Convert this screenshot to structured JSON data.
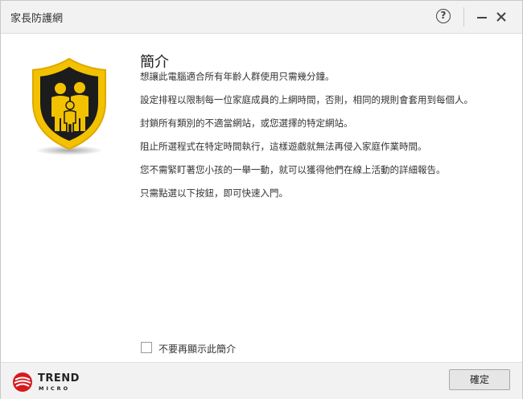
{
  "window": {
    "title": "家長防護網",
    "help_icon": "question-circle-icon",
    "minimize_icon": "minimize-icon",
    "close_icon": "close-icon"
  },
  "intro": {
    "icon": "family-shield-icon",
    "heading": "簡介",
    "paragraphs": [
      "想讓此電腦適合所有年齡人群使用只需幾分鐘。",
      "設定排程以限制每一位家庭成員的上網時間，否則，相同的規則會套用到每個人。",
      "封鎖所有類別的不適當網站，或您選擇的特定網站。",
      "阻止所選程式在特定時間執行，這樣遊戲就無法再侵入家庭作業時間。",
      "您不需緊盯著您小孩的一舉一動，就可以獲得他們在線上活動的詳細報告。",
      "只需點選以下按鈕，即可快速入門。"
    ]
  },
  "dont_show": {
    "label": "不要再顯示此簡介",
    "checked": false
  },
  "footer": {
    "logo_icon": "trend-micro-logo-icon",
    "logo_line1": "TREND",
    "logo_line2": "MICRO",
    "ok_label": "確定"
  },
  "colors": {
    "shield_yellow": "#f2c200",
    "shield_border": "#e0a800",
    "shield_inner": "#1c1c1c",
    "logo_red": "#d71920",
    "titlebar_bg": "#f2f2f2",
    "footer_bg": "#f2f2f2"
  }
}
